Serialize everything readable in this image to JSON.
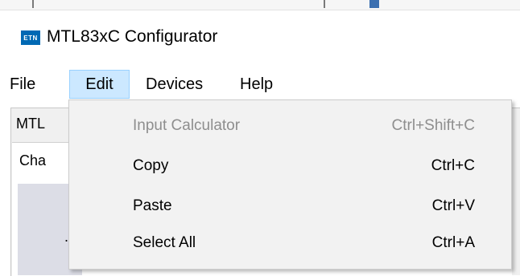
{
  "window": {
    "logo_text": "ETN",
    "title": "MTL83xC Configurator"
  },
  "menubar": {
    "items": [
      {
        "label": "File"
      },
      {
        "label": "Edit",
        "active": true
      },
      {
        "label": "Devices"
      },
      {
        "label": "Help"
      }
    ]
  },
  "background": {
    "tab_partial": "MTL",
    "inner_tab_partial": "Cha",
    "inner_mark": "."
  },
  "edit_menu": {
    "items": [
      {
        "label": "Input Calculator",
        "shortcut": "Ctrl+Shift+C",
        "enabled": false
      },
      {
        "label": "Copy",
        "shortcut": "Ctrl+C",
        "enabled": true
      },
      {
        "label": "Paste",
        "shortcut": "Ctrl+V",
        "enabled": true
      },
      {
        "label": "Select All",
        "shortcut": "Ctrl+A",
        "enabled": true
      }
    ]
  },
  "colors": {
    "menu_highlight": "#cce8ff",
    "logo_blue": "#0069b4",
    "disabled_text": "#8e8e8e"
  }
}
